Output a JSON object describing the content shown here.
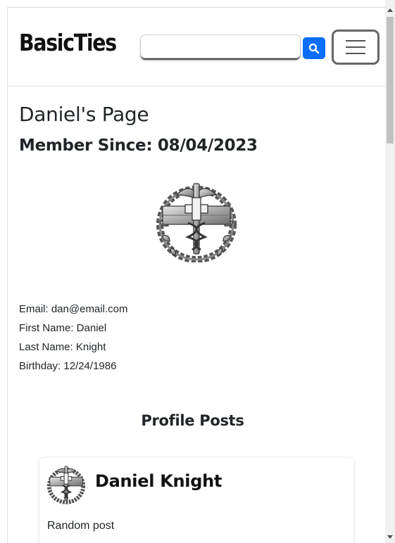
{
  "navbar": {
    "brand": "BasicTies",
    "search": {
      "value": "",
      "placeholder": ""
    },
    "search_icon": "search-icon",
    "menu_icon": "hamburger-menu-icon",
    "accent_color": "#0d6efd"
  },
  "profile": {
    "title": "Daniel's Page",
    "member_since": "Member Since: 08/04/2023",
    "badge_icon": "combat-medical-badge-icon",
    "info": {
      "email": "Email: dan@email.com",
      "first_name": "First Name: Daniel",
      "last_name": "Last Name: Knight",
      "birthday": "Birthday: 12/24/1986"
    }
  },
  "posts": {
    "heading": "Profile Posts",
    "items": [
      {
        "author": "Daniel Knight",
        "body": "Random post",
        "avatar_icon": "combat-medical-badge-icon"
      }
    ]
  }
}
